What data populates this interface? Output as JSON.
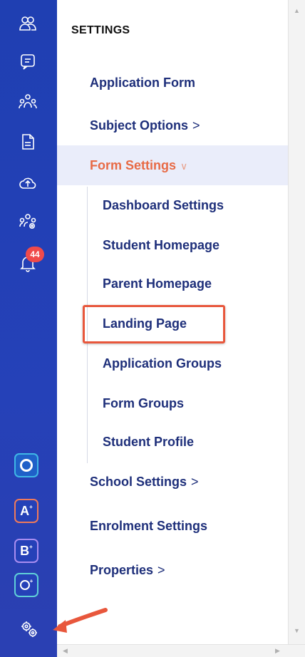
{
  "rail": {
    "icons": [
      "users-icon",
      "chat-icon",
      "group-icon",
      "document-icon",
      "cloud-upload-icon",
      "group-settings-icon",
      "bell-icon"
    ],
    "notification_count": "44",
    "apps": [
      {
        "name": "app-o",
        "letter": "",
        "color": "#3fb7e6"
      },
      {
        "name": "app-a",
        "letter": "A",
        "sup": "+",
        "color": "#f07a5a"
      },
      {
        "name": "app-b",
        "letter": "B",
        "sup": "+",
        "color": "#a98df0"
      },
      {
        "name": "app-o-plus",
        "letter": "",
        "sup": "+",
        "color": "#5fd0d8"
      }
    ],
    "settings_icon": "gears-icon"
  },
  "panel": {
    "title": "SETTINGS",
    "items": [
      {
        "label": "Application Form",
        "chevron": ""
      },
      {
        "label": "Subject Options",
        "chevron": ">"
      },
      {
        "label": "Form Settings",
        "chevron": "∨"
      },
      {
        "label": "School Settings",
        "chevron": ">"
      },
      {
        "label": "Enrolment Settings",
        "chevron": ""
      },
      {
        "label": "Properties",
        "chevron": ">"
      }
    ],
    "sub_items": [
      "Dashboard Settings",
      "Student Homepage",
      "Parent Homepage",
      "Landing Page",
      "Application Groups",
      "Form Groups",
      "Student Profile"
    ]
  },
  "colors": {
    "rail": "#2541b8",
    "accent": "#e86a45",
    "menu_text": "#1e2f7a",
    "highlight": "#e8573c"
  }
}
